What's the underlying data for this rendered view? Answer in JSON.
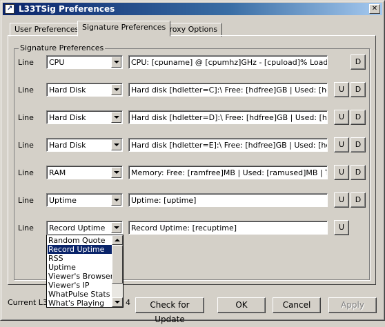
{
  "window": {
    "title": "L33TSig Preferences",
    "close_glyph": "✕",
    "app_icon_glyph": "↗"
  },
  "tabs": [
    "User Preferences",
    "Signature Preferences",
    "Proxy Options"
  ],
  "group_title": "Signature Preferences",
  "line_label": "Line",
  "rows": [
    {
      "type": "CPU",
      "text": "CPU: [cpuname] @ [cpumhz]GHz - [cpuload]% Load",
      "buttons": [
        "D"
      ]
    },
    {
      "type": "Hard Disk",
      "text": "Hard disk [hdletter=C]:\\ Free: [hdfree]GB | Used: [hdused]",
      "buttons": [
        "U",
        "D"
      ]
    },
    {
      "type": "Hard Disk",
      "text": "Hard disk [hdletter=D]:\\ Free: [hdfree]GB | Used: [hdused]",
      "buttons": [
        "U",
        "D"
      ]
    },
    {
      "type": "Hard Disk",
      "text": "Hard disk [hdletter=E]:\\ Free: [hdfree]GB | Used: [hdused]",
      "buttons": [
        "U",
        "D"
      ]
    },
    {
      "type": "RAM",
      "text": "Memory: Free: [ramfree]MB | Used: [ramused]MB | Total: [",
      "buttons": [
        "U",
        "D"
      ]
    },
    {
      "type": "Uptime",
      "text": "Uptime: [uptime]",
      "buttons": [
        "U",
        "D"
      ]
    },
    {
      "type": "Record Uptime",
      "text": "Record Uptime: [recuptime]",
      "buttons": [
        "U"
      ]
    }
  ],
  "dropdown": {
    "options": [
      "Random Quote",
      "Record Uptime",
      "RSS",
      "Uptime",
      "Viewer's Browser",
      "Viewer's IP",
      "WhatPulse Stats",
      "What's Playing"
    ],
    "selected": "Record Uptime"
  },
  "status_text": "Current L33",
  "status_suffix": "4",
  "footer": {
    "check_update": "Check for Update",
    "ok": "OK",
    "cancel": "Cancel",
    "apply": "Apply"
  }
}
